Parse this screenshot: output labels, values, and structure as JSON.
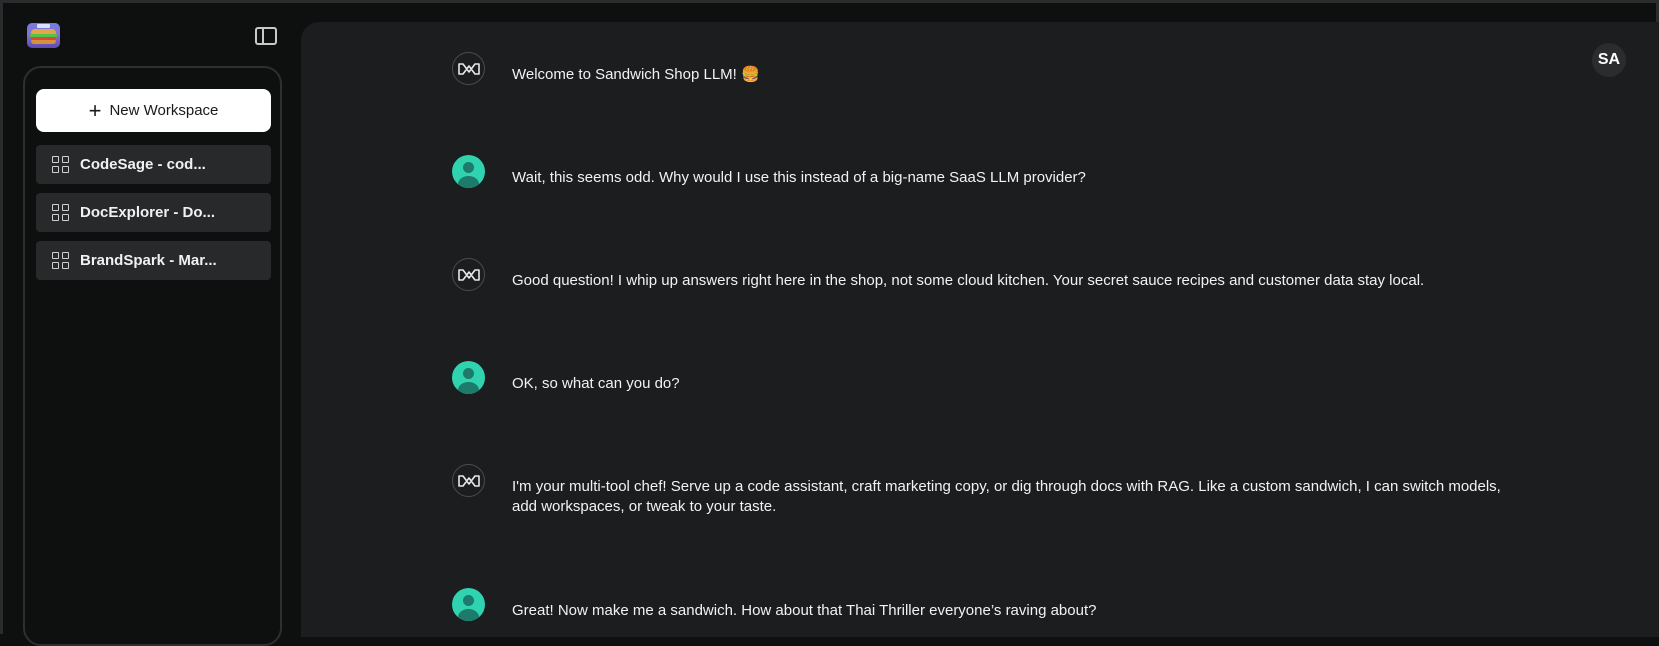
{
  "sidebar": {
    "new_workspace_label": "New Workspace",
    "workspaces": [
      {
        "label": "CodeSage - cod..."
      },
      {
        "label": "DocExplorer - Do..."
      },
      {
        "label": "BrandSpark - Mar..."
      }
    ]
  },
  "header": {
    "user_initials": "SA"
  },
  "chat": {
    "messages": [
      {
        "role": "assistant",
        "text": "Welcome to Sandwich Shop LLM! 🍔"
      },
      {
        "role": "user",
        "text": "Wait, this seems odd. Why would I use this instead of a big-name SaaS LLM provider?"
      },
      {
        "role": "assistant",
        "text": "Good question! I whip up answers right here in the shop, not some cloud kitchen. Your secret sauce recipes and customer data stay local."
      },
      {
        "role": "user",
        "text": "OK, so what can you do?"
      },
      {
        "role": "assistant",
        "text": "I'm your multi-tool chef! Serve up a code assistant, craft marketing copy, or dig through docs with RAG. Like a custom sandwich, I can switch models, add workspaces, or tweak to your taste."
      },
      {
        "role": "user",
        "text": "Great! Now make me a sandwich. How about that Thai Thriller everyone’s raving about?"
      }
    ]
  },
  "colors": {
    "accent_user_avatar": "#2fd3b0",
    "main_background": "#1c1d1e",
    "sidebar_background": "#0e0f0f",
    "workspace_item": "#27292a"
  }
}
